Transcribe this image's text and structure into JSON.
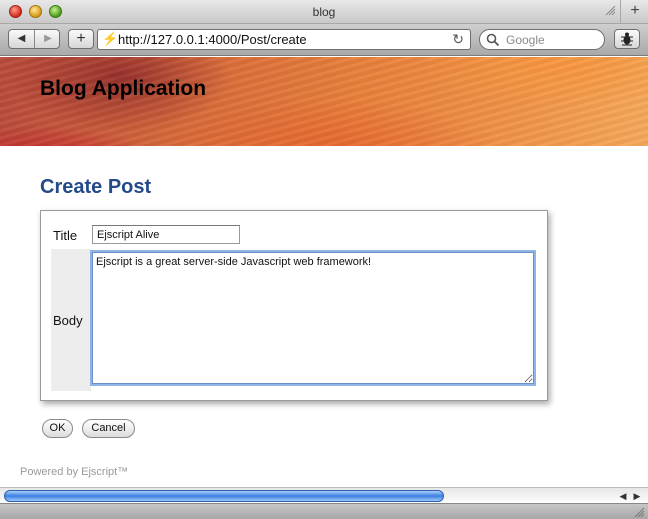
{
  "window": {
    "title": "blog",
    "new_tab_label": "+"
  },
  "toolbar": {
    "back_label": "◀",
    "forward_label": "▶",
    "add_label": "+",
    "url": "http://127.0.0.1:4000/Post/create",
    "search_placeholder": "Google",
    "reload_icon": "reload-icon"
  },
  "banner": {
    "app_title": "Blog Application"
  },
  "page": {
    "heading": "Create Post",
    "form": {
      "title_label": "Title",
      "title_value": "Ejscript Alive",
      "body_label": "Body",
      "body_value": "Ejscript is a great server-side Javascript web framework!"
    },
    "buttons": {
      "ok": "OK",
      "cancel": "Cancel"
    },
    "footer": "Powered by Ejscript™"
  },
  "colors": {
    "heading": "#254a8a",
    "footer": "#9a9a9a",
    "accent_scroll": "#3c7fe0"
  }
}
